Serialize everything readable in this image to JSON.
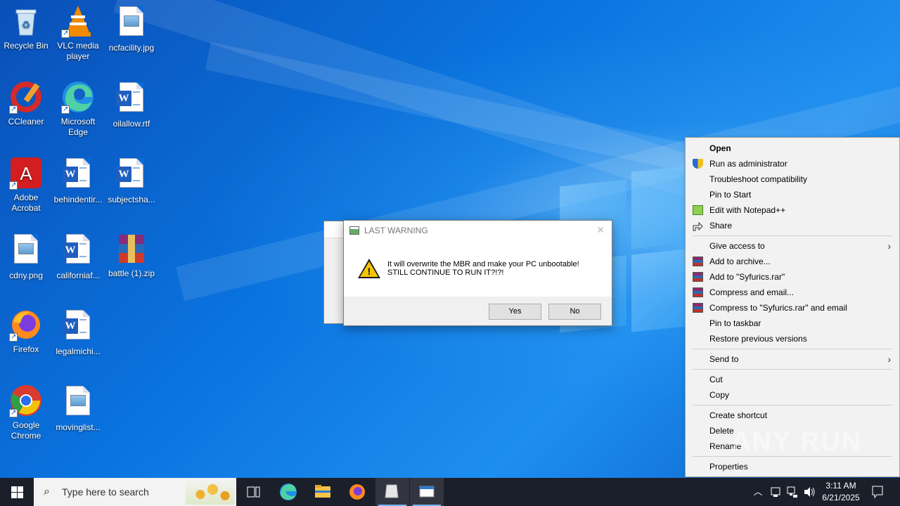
{
  "desktop": {
    "icons": [
      {
        "label": "Recycle Bin",
        "icon": "recycle-bin-icon"
      },
      {
        "label": "VLC media player",
        "icon": "vlc-icon"
      },
      {
        "label": "ncfacility.jpg",
        "icon": "image-file-icon"
      },
      {
        "label": "CCleaner",
        "icon": "ccleaner-icon"
      },
      {
        "label": "Microsoft Edge",
        "icon": "edge-icon"
      },
      {
        "label": "oilallow.rtf",
        "icon": "word-doc-icon"
      },
      {
        "label": "Adobe Acrobat",
        "icon": "acrobat-icon"
      },
      {
        "label": "behindentir...",
        "icon": "word-doc-icon"
      },
      {
        "label": "subjectsha...",
        "icon": "word-doc-icon"
      },
      {
        "label": "cdny.png",
        "icon": "image-file-icon"
      },
      {
        "label": "californiaf...",
        "icon": "word-doc-icon"
      },
      {
        "label": "battle (1).zip",
        "icon": "winrar-archive-icon"
      },
      {
        "label": "Firefox",
        "icon": "firefox-icon"
      },
      {
        "label": "legalmichi...",
        "icon": "word-doc-icon"
      },
      {
        "label": "Google Chrome",
        "icon": "chrome-icon"
      },
      {
        "label": "movinglist...",
        "icon": "image-file-icon"
      }
    ]
  },
  "dialog": {
    "title": "LAST WARNING",
    "message_line1": "It will overwrite the MBR and make your PC unbootable!",
    "message_line2": "STILL CONTINUE TO RUN IT?!?!",
    "yes_label": "Yes",
    "no_label": "No",
    "close_glyph": "✕"
  },
  "context_menu": {
    "items": [
      {
        "label": "Open",
        "bold": true
      },
      {
        "label": "Run as administrator",
        "icon": "uac-shield-icon"
      },
      {
        "label": "Troubleshoot compatibility"
      },
      {
        "label": "Pin to Start"
      },
      {
        "label": "Edit with Notepad++",
        "icon": "notepad-plus-plus-icon"
      },
      {
        "label": "Share",
        "icon": "share-icon"
      },
      {
        "label": "Give access to",
        "submenu": true
      },
      {
        "label": "Add to archive...",
        "icon": "winrar-icon"
      },
      {
        "label": "Add to \"Syfurics.rar\"",
        "icon": "winrar-icon"
      },
      {
        "label": "Compress and email...",
        "icon": "winrar-icon"
      },
      {
        "label": "Compress to \"Syfurics.rar\" and email",
        "icon": "winrar-icon"
      },
      {
        "label": "Pin to taskbar"
      },
      {
        "label": "Restore previous versions"
      },
      {
        "label": "Send to",
        "submenu": true
      },
      {
        "label": "Cut"
      },
      {
        "label": "Copy"
      },
      {
        "label": "Create shortcut"
      },
      {
        "label": "Delete"
      },
      {
        "label": "Rename"
      },
      {
        "label": "Properties"
      }
    ]
  },
  "watermark": "ANY RUN",
  "taskbar": {
    "search_placeholder": "Type here to search",
    "time": "3:11 AM",
    "date": "6/21/2025"
  },
  "colors": {
    "accent": "#0a6bd8",
    "taskbar": "#1b1f2a",
    "menu_bg": "#f2f2f2"
  }
}
